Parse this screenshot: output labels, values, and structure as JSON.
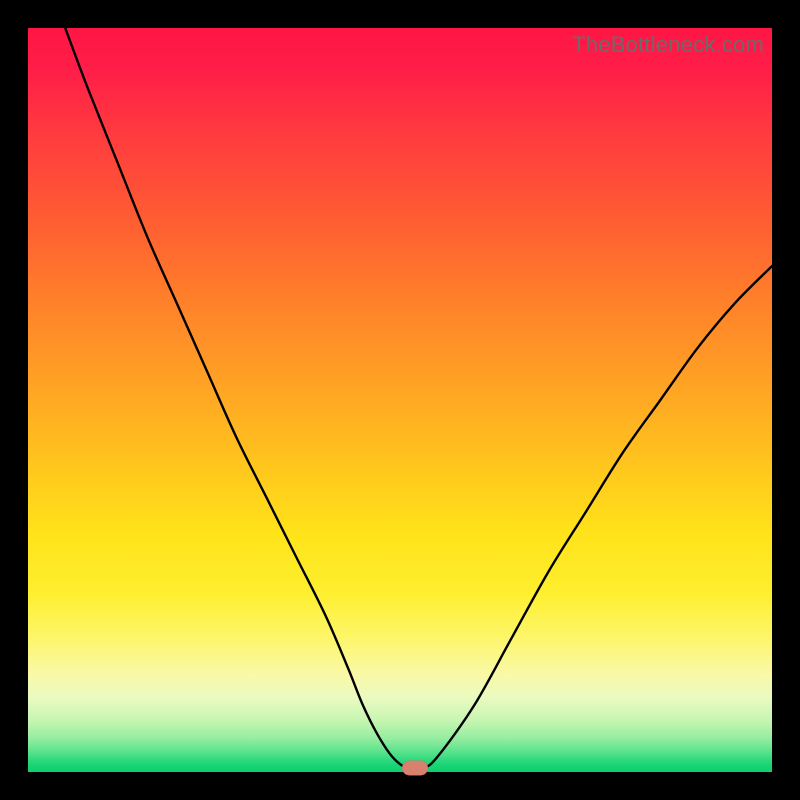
{
  "watermark": "TheBottleneck.com",
  "colors": {
    "frame": "#000000",
    "curve": "#000000",
    "marker": "#d9816f",
    "gradient_top": "#ff1545",
    "gradient_bottom": "#0fce6f"
  },
  "chart_data": {
    "type": "line",
    "title": "",
    "xlabel": "",
    "ylabel": "",
    "xlim": [
      0,
      100
    ],
    "ylim": [
      0,
      100
    ],
    "x": [
      5,
      8,
      12,
      16,
      20,
      24,
      28,
      32,
      36,
      40,
      43,
      45,
      47,
      49,
      51,
      53,
      55,
      60,
      65,
      70,
      75,
      80,
      85,
      90,
      95,
      100
    ],
    "values": [
      100,
      92,
      82,
      72,
      63,
      54,
      45,
      37,
      29,
      21,
      14,
      9,
      5,
      2,
      0.5,
      0.5,
      2,
      9,
      18,
      27,
      35,
      43,
      50,
      57,
      63,
      68
    ],
    "series": [
      {
        "name": "bottleneck_curve",
        "x": [
          5,
          8,
          12,
          16,
          20,
          24,
          28,
          32,
          36,
          40,
          43,
          45,
          47,
          49,
          51,
          53,
          55,
          60,
          65,
          70,
          75,
          80,
          85,
          90,
          95,
          100
        ],
        "values": [
          100,
          92,
          82,
          72,
          63,
          54,
          45,
          37,
          29,
          21,
          14,
          9,
          5,
          2,
          0.5,
          0.5,
          2,
          9,
          18,
          27,
          35,
          43,
          50,
          57,
          63,
          68
        ]
      }
    ],
    "marker": {
      "x": 52,
      "y": 0.5
    },
    "background_gradient": {
      "direction": "vertical",
      "stops": [
        {
          "pos": 0.0,
          "color": "#ff1545"
        },
        {
          "pos": 0.25,
          "color": "#ff5a33"
        },
        {
          "pos": 0.5,
          "color": "#ffa324"
        },
        {
          "pos": 0.7,
          "color": "#ffe31a"
        },
        {
          "pos": 0.88,
          "color": "#f9f9a8"
        },
        {
          "pos": 0.96,
          "color": "#5de38d"
        },
        {
          "pos": 1.0,
          "color": "#0fce6f"
        }
      ]
    }
  }
}
